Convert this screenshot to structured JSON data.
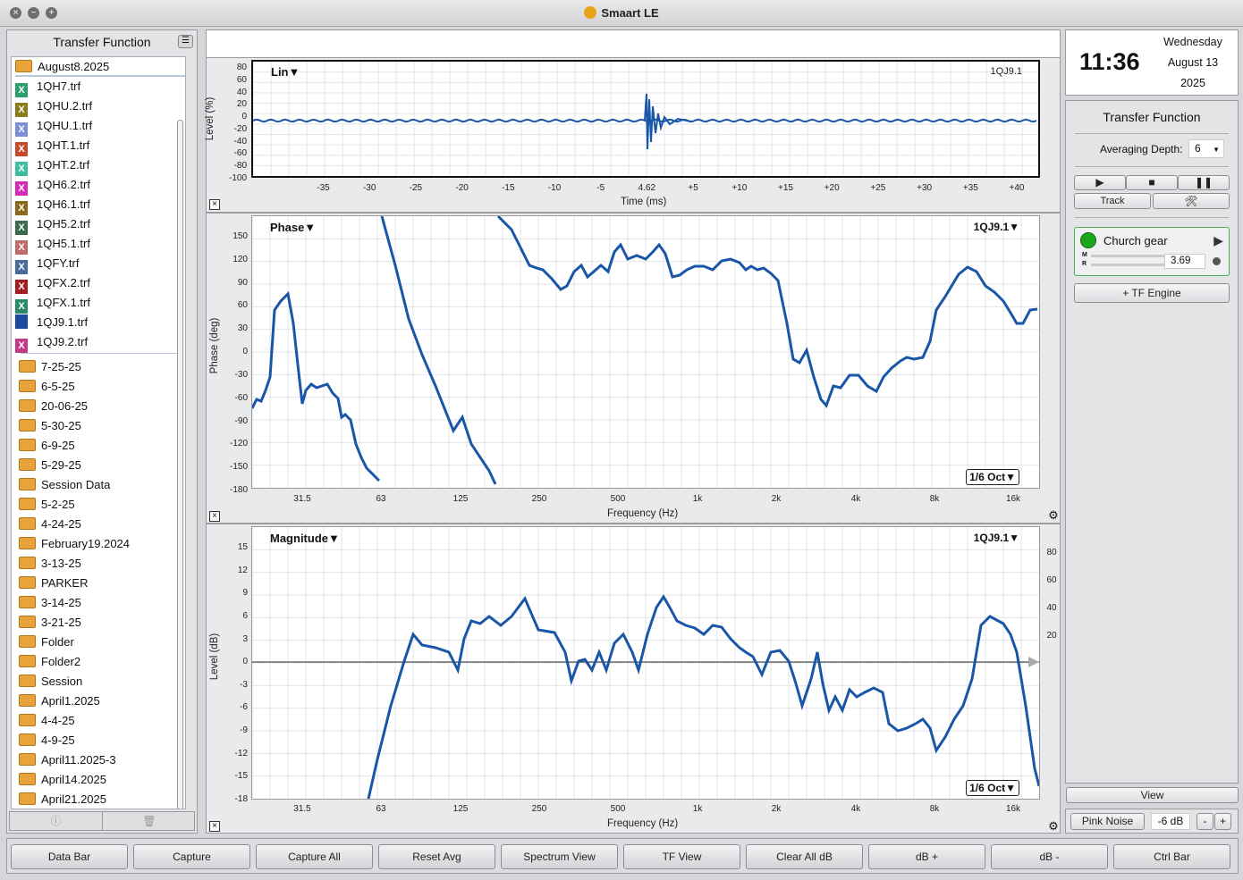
{
  "window": {
    "title": "Smaart LE"
  },
  "left_panel": {
    "title": "Transfer Function",
    "open_folder": "August8.2025",
    "files": [
      {
        "name": "1QH7.trf",
        "color": "#2aa06e"
      },
      {
        "name": "1QHU.2.trf",
        "color": "#8a7a1a"
      },
      {
        "name": "1QHU.1.trf",
        "color": "#7a8ed6"
      },
      {
        "name": "1QHT.1.trf",
        "color": "#c64a2a"
      },
      {
        "name": "1QHT.2.trf",
        "color": "#3cbfa0"
      },
      {
        "name": "1QH6.2.trf",
        "color": "#d62ab4"
      },
      {
        "name": "1QH6.1.trf",
        "color": "#8a6a1a"
      },
      {
        "name": "1QH5.2.trf",
        "color": "#3a6a4a"
      },
      {
        "name": "1QH5.1.trf",
        "color": "#c06a6a"
      },
      {
        "name": "1QFY.trf",
        "color": "#4a6a9a"
      },
      {
        "name": "1QFX.2.trf",
        "color": "#a02020"
      },
      {
        "name": "1QFX.1.trf",
        "color": "#2a8a6a"
      },
      {
        "name": "1QJ9.1.trf",
        "color": "#1a4aa0"
      },
      {
        "name": "1QJ9.2.trf",
        "color": "#c03a8a"
      }
    ],
    "folders": [
      "7-25-25",
      "6-5-25",
      "20-06-25",
      "5-30-25",
      "6-9-25",
      "5-29-25",
      "Session Data",
      "5-2-25",
      "4-24-25",
      "February19.2024",
      "3-13-25",
      "PARKER",
      "3-14-25",
      "3-21-25",
      "Folder",
      "Folder2",
      "Session",
      "April1.2025",
      "4-4-25",
      "4-9-25",
      "April11.2025-3",
      "April14.2025",
      "April21.2025"
    ]
  },
  "impulse": {
    "label": "Lin▼",
    "trace": "1QJ9.1",
    "ylabel": "Level (%)",
    "xlabel": "Time (ms)",
    "yticks": [
      "80",
      "60",
      "40",
      "20",
      "0",
      "-20",
      "-40",
      "-60",
      "-80",
      "-100"
    ],
    "xticks": [
      "-35",
      "-30",
      "-25",
      "-20",
      "-15",
      "-10",
      "-5",
      "4.62",
      "+5",
      "+10",
      "+15",
      "+20",
      "+25",
      "+30",
      "+35",
      "+40"
    ]
  },
  "phase": {
    "label": "Phase▼",
    "trace": "1QJ9.1▼",
    "ylabel": "Phase (deg)",
    "xlabel": "Frequency (Hz)",
    "yticks": [
      "150",
      "120",
      "90",
      "60",
      "30",
      "0",
      "-30",
      "-60",
      "-90",
      "-120",
      "-150",
      "-180"
    ],
    "xticks": [
      "31.5",
      "63",
      "125",
      "250",
      "500",
      "1k",
      "2k",
      "4k",
      "8k",
      "16k"
    ],
    "smoothing": "1/6 Oct▼"
  },
  "magnitude": {
    "label": "Magnitude▼",
    "trace": "1QJ9.1▼",
    "ylabel": "Level (dB)",
    "xlabel": "Frequency (Hz)",
    "yticks": [
      "15",
      "12",
      "9",
      "6",
      "3",
      "0",
      "-3",
      "-6",
      "-9",
      "-12",
      "-15",
      "-18"
    ],
    "yticks_right": [
      "80",
      "60",
      "40",
      "20"
    ],
    "xticks": [
      "31.5",
      "63",
      "125",
      "250",
      "500",
      "1k",
      "2k",
      "4k",
      "8k",
      "16k"
    ],
    "smoothing": "1/6 Oct▼"
  },
  "clock": {
    "time": "11:36",
    "weekday": "Wednesday",
    "date": "August 13",
    "year": "2025"
  },
  "tf_panel": {
    "title": "Transfer Function",
    "averaging_label": "Averaging Depth:",
    "averaging_value": "6",
    "track_label": "Track",
    "engine_name": "Church gear",
    "delay_value": "3.69",
    "meter_m": "M",
    "meter_r": "R",
    "add_engine": "+ TF Engine",
    "view_label": "View",
    "pink_noise": "Pink Noise",
    "noise_level": "-6 dB",
    "minus": "-",
    "plus": "+"
  },
  "bottom_buttons": [
    "Data Bar",
    "Capture",
    "Capture All",
    "Reset Avg",
    "Spectrum View",
    "TF View",
    "Clear All dB",
    "dB +",
    "dB -",
    "Ctrl Bar"
  ],
  "colors": {
    "trace": "#1a56a8",
    "accent": "#4caf50"
  }
}
